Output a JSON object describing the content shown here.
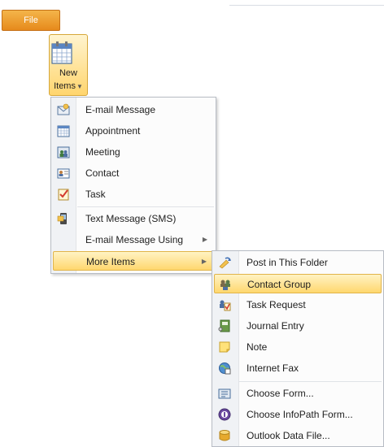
{
  "ribbon": {
    "file_tab": "File",
    "new_items_line1": "New",
    "new_items_line2": "Items"
  },
  "new_items_menu": [
    {
      "label": "E-mail Message",
      "icon": "email-message-icon"
    },
    {
      "label": "Appointment",
      "icon": "appointment-icon"
    },
    {
      "label": "Meeting",
      "icon": "meeting-icon"
    },
    {
      "label": "Contact",
      "icon": "contact-icon"
    },
    {
      "label": "Task",
      "icon": "task-icon"
    },
    {
      "label": "Text Message (SMS)",
      "icon": "text-message-icon"
    },
    {
      "label": "E-mail Message Using",
      "icon": null
    },
    {
      "label": "More Items",
      "icon": null
    }
  ],
  "more_items_menu": [
    {
      "label": "Post in This Folder",
      "icon": "post-icon"
    },
    {
      "label": "Contact Group",
      "icon": "contact-group-icon"
    },
    {
      "label": "Task Request",
      "icon": "task-request-icon"
    },
    {
      "label": "Journal Entry",
      "icon": "journal-entry-icon"
    },
    {
      "label": "Note",
      "icon": "note-icon"
    },
    {
      "label": "Internet Fax",
      "icon": "internet-fax-icon"
    },
    {
      "label": "Choose Form...",
      "icon": "choose-form-icon"
    },
    {
      "label": "Choose InfoPath Form...",
      "icon": "infopath-form-icon"
    },
    {
      "label": "Outlook Data File...",
      "icon": "outlook-data-file-icon"
    }
  ],
  "colors": {
    "file_tab": "#e68a1c",
    "highlight": "#ffd76e",
    "menu_border": "#b7bcc4"
  }
}
